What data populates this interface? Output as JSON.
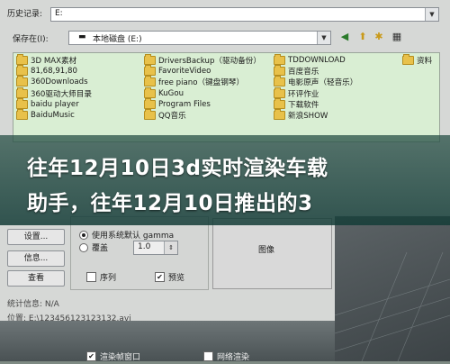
{
  "dialog": {
    "history_label": "历史记录:",
    "history_value": "E:",
    "save_in_label": "保存在(I):",
    "save_in_value": "本地磁盘 (E:)"
  },
  "files": {
    "col1": [
      "3D MAX素材",
      "81,68,91,80",
      "360Downloads",
      "360驱动大师目录",
      "baidu player",
      "BaiduMusic"
    ],
    "col2": [
      "DriversBackup（驱动备份）",
      "FavoriteVideo",
      "free piano（键盘钢琴）",
      "KuGou",
      "Program Files",
      "QQ音乐"
    ],
    "col3": [
      "TDDOWNLOAD",
      "百度音乐",
      "电影原声（轻音乐）",
      "环评作业",
      "下载软件",
      "新浪SHOW"
    ],
    "col4": [
      "资料"
    ]
  },
  "banner": {
    "line1": "往年12月10日3d实时渲染车载",
    "line2": "助手，往年12月10日推出的3"
  },
  "left_buttons": {
    "setup": "设置...",
    "info": "信息...",
    "view": "查看"
  },
  "gamma": {
    "use_system": "使用系统默认 gamma",
    "override": "覆盖",
    "override_value": "1.0",
    "sequence": "序列",
    "preview": "预览"
  },
  "preview_label": "图像",
  "stats_label": "统计信息: N/A",
  "location_label": "位置: E:\\123456123123132.avi",
  "bottom": {
    "render_window": "渲染帧窗口",
    "network_render": "网络渲染"
  },
  "colors": {
    "file_list_bg": "#d9eed3",
    "banner": "#2a5a50"
  }
}
